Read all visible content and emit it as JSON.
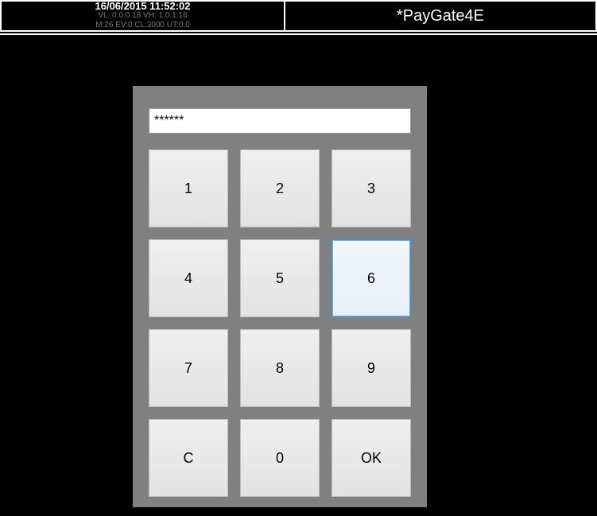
{
  "header": {
    "datetime": "16/06/2015 11:52:02",
    "versions": "VL: 0.0.0.18 VH: 1.0.1.16",
    "metrics": "M:26 EV:0 CL:3000 UT:0.0",
    "title": "*PayGate4E"
  },
  "keypad": {
    "display": "******",
    "keys": [
      {
        "label": "1",
        "name": "key-1",
        "hl": false
      },
      {
        "label": "2",
        "name": "key-2",
        "hl": false
      },
      {
        "label": "3",
        "name": "key-3",
        "hl": false
      },
      {
        "label": "4",
        "name": "key-4",
        "hl": false
      },
      {
        "label": "5",
        "name": "key-5",
        "hl": false
      },
      {
        "label": "6",
        "name": "key-6",
        "hl": true
      },
      {
        "label": "7",
        "name": "key-7",
        "hl": false
      },
      {
        "label": "8",
        "name": "key-8",
        "hl": false
      },
      {
        "label": "9",
        "name": "key-9",
        "hl": false
      },
      {
        "label": "C",
        "name": "key-clear",
        "hl": false
      },
      {
        "label": "0",
        "name": "key-0",
        "hl": false
      },
      {
        "label": "OK",
        "name": "key-ok",
        "hl": false
      }
    ]
  }
}
